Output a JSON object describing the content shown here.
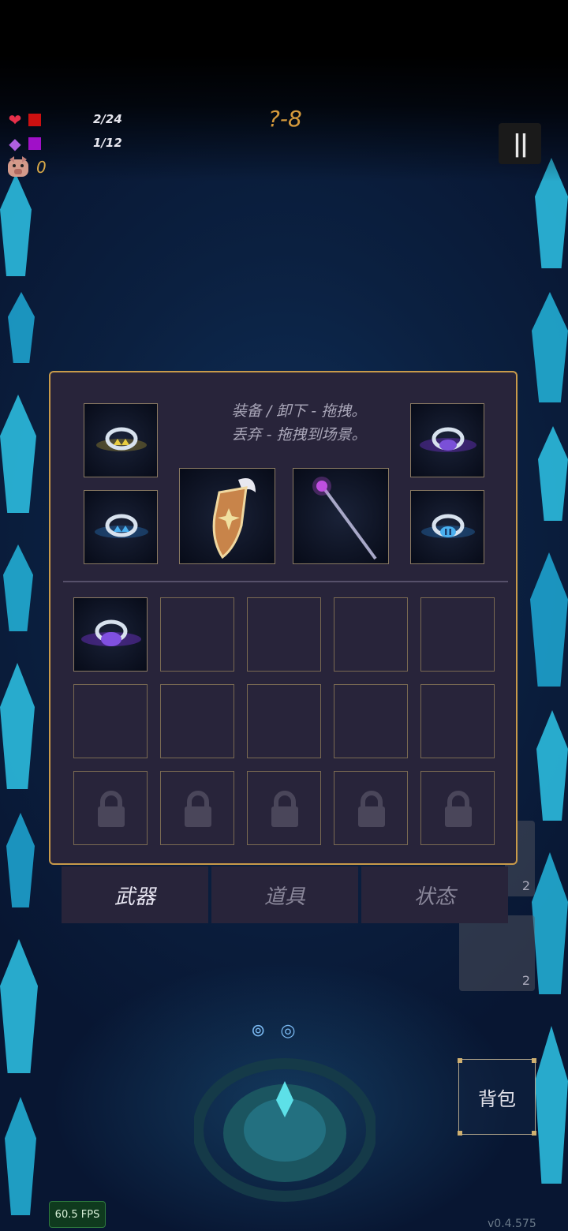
{
  "hud": {
    "hp": "2/24",
    "mana": "1/12",
    "coins": "0",
    "level": "?-8"
  },
  "panel": {
    "hint_line1": "装备 / 卸下 - 拖拽。",
    "hint_line2": "丢弃 - 拖拽到场景。"
  },
  "tabs": [
    "武器",
    "道具",
    "状态"
  ],
  "bag_label": "背包",
  "fps": "60.5 FPS",
  "version": "v0.4.575",
  "side_counts": [
    "2",
    "2"
  ],
  "colors": {
    "panel_bg": "#28243a",
    "panel_border": "#c89a4a",
    "level_text": "#d69a3c",
    "crystal": "#2ec4e8"
  },
  "equipped": {
    "ring_top_left": "gold-ring-icon",
    "ring_bottom_left": "blue-ring-icon",
    "shield": "winged-shield-icon",
    "staff": "magic-staff-icon",
    "ring_top_right": "purple-swirl-ring-icon",
    "ring_bottom_right": "blue-pause-ring-icon"
  },
  "inventory": {
    "filled_slot_1": "purple-moon-ring-icon",
    "rows": 3,
    "cols": 5,
    "locked_row": 3
  }
}
